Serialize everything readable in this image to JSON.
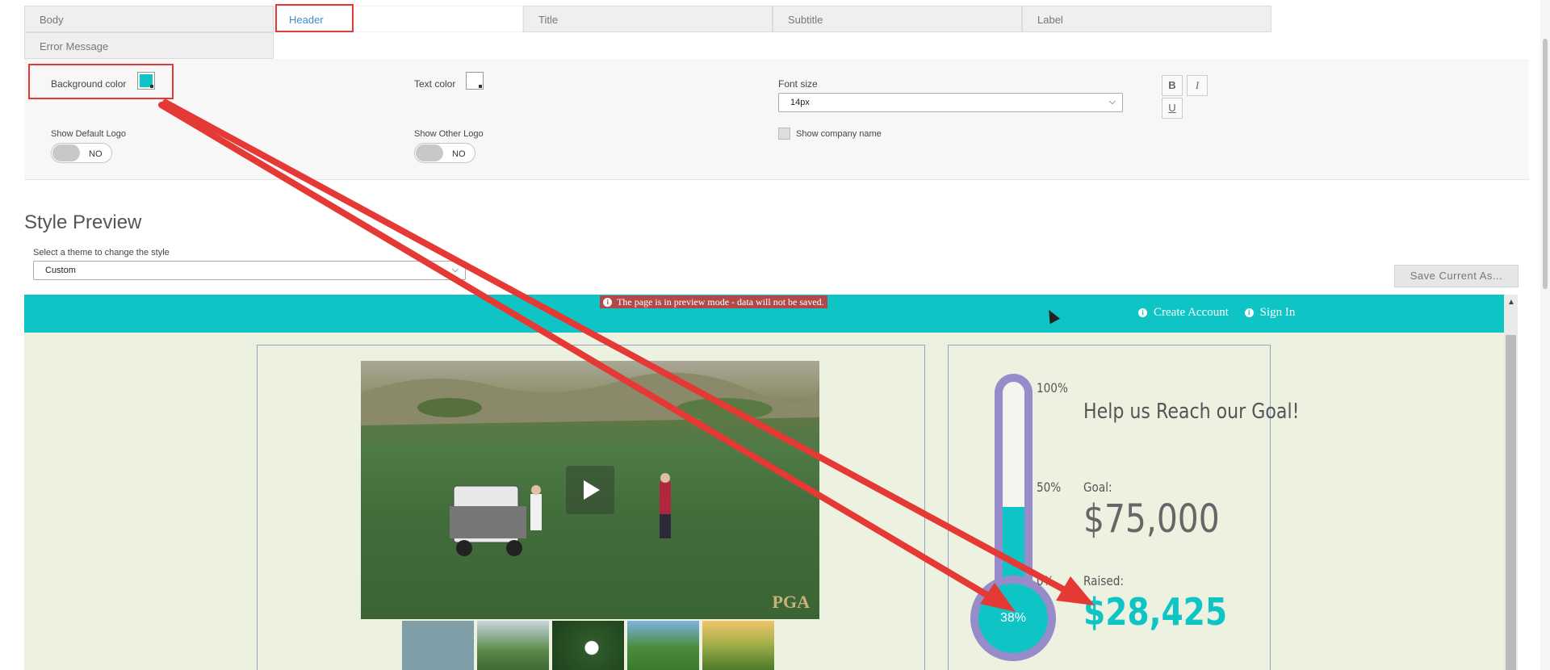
{
  "tabs": [
    {
      "label": "Body",
      "active": false
    },
    {
      "label": "Header",
      "active": true
    },
    {
      "label": "Title",
      "active": false
    },
    {
      "label": "Subtitle",
      "active": false
    },
    {
      "label": "Label",
      "active": false
    },
    {
      "label": "Error Message",
      "active": false
    }
  ],
  "settings": {
    "background_color_label": "Background color",
    "background_color_value": "#0fc4c5",
    "text_color_label": "Text color",
    "text_color_value": "#ffffff",
    "font_size_label": "Font size",
    "font_size_value": "14px",
    "bold": "B",
    "italic": "I",
    "underline": "U",
    "show_default_logo_label": "Show Default Logo",
    "show_default_logo_value": "NO",
    "show_other_logo_label": "Show Other Logo",
    "show_other_logo_value": "NO",
    "show_company_name_label": "Show company name"
  },
  "preview_section": {
    "title": "Style Preview",
    "theme_label": "Select a theme to change the style",
    "theme_value": "Custom",
    "save_button": "Save Current As..."
  },
  "preview": {
    "banner": "The page is in preview mode - data will not be saved.",
    "create_account": "Create Account",
    "sign_in": "Sign In",
    "pga_logo": "PGA",
    "thermometer": {
      "percent": 38,
      "percent_label": "38%",
      "tick_100": "100%",
      "tick_50": "50%",
      "tick_0": "0%"
    },
    "goal_title": "Help us Reach our Goal!",
    "goal_label": "Goal:",
    "goal_value": "$75,000",
    "raised_label": "Raised:",
    "raised_value": "$28,425"
  },
  "colors": {
    "header_teal": "#0fc4c5",
    "highlight_red": "#e53935",
    "thermometer_purple": "#978bc9",
    "preview_bg": "#edf1e0"
  }
}
